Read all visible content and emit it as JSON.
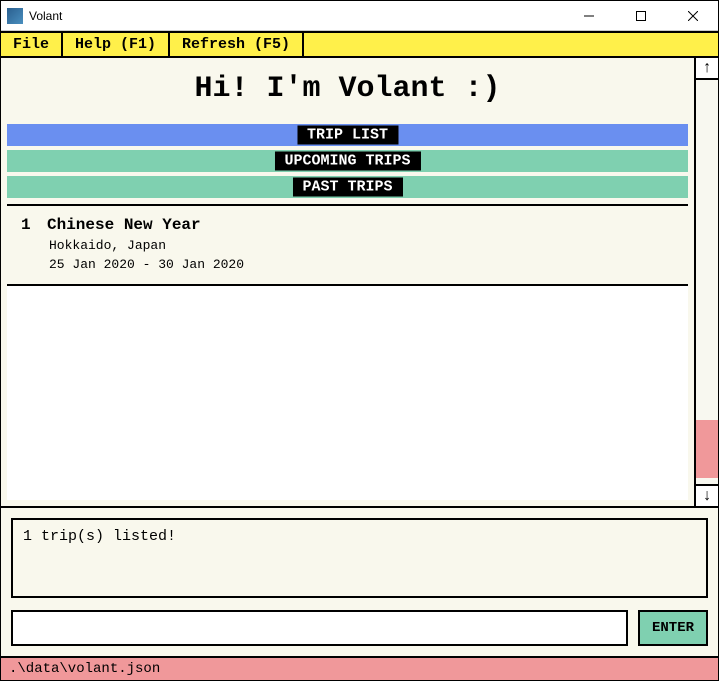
{
  "window": {
    "title": "Volant"
  },
  "menu": {
    "file": "File",
    "help": "Help (F1)",
    "refresh": "Refresh (F5)"
  },
  "greeting": "Hi! I'm Volant :)",
  "sections": {
    "trip_list": "TRIP LIST",
    "upcoming": "UPCOMING TRIPS",
    "past": "PAST TRIPS"
  },
  "trips": [
    {
      "index": "1",
      "title": "Chinese New Year",
      "location": "Hokkaido, Japan",
      "dates": "25 Jan 2020 - 30 Jan 2020"
    }
  ],
  "console": {
    "output": "1 trip(s) listed!",
    "input_value": "",
    "enter_label": "ENTER"
  },
  "status": {
    "path": ".\\data\\volant.json"
  },
  "scroll": {
    "up_glyph": "↑",
    "down_glyph": "↓"
  }
}
